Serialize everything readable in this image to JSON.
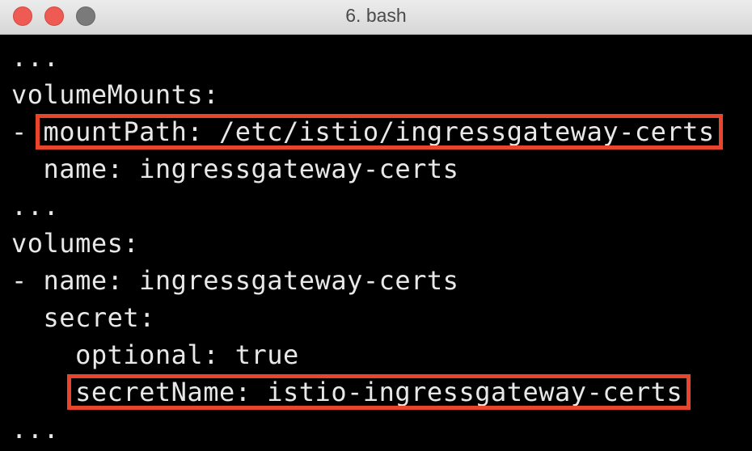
{
  "window": {
    "title": "6. bash"
  },
  "terminal": {
    "lines": [
      {
        "prefix": "...",
        "highlight": ""
      },
      {
        "prefix": "volumeMounts:",
        "highlight": ""
      },
      {
        "prefix": "- ",
        "highlight": "mountPath: /etc/istio/ingressgateway-certs"
      },
      {
        "prefix": "  name: ingressgateway-certs",
        "highlight": ""
      },
      {
        "prefix": "...",
        "highlight": ""
      },
      {
        "prefix": "volumes:",
        "highlight": ""
      },
      {
        "prefix": "- name: ingressgateway-certs",
        "highlight": ""
      },
      {
        "prefix": "  secret:",
        "highlight": ""
      },
      {
        "prefix": "    optional: true",
        "highlight": ""
      },
      {
        "prefix": "    ",
        "highlight": "secretName: istio-ingressgateway-certs"
      },
      {
        "prefix": "...",
        "highlight": ""
      }
    ]
  },
  "colors": {
    "background": "#000000",
    "text": "#e8e8e8",
    "highlight_border": "#e8452c",
    "titlebar": "#e2e2e2"
  },
  "icons": {
    "close": "close-button-icon",
    "minimize": "minimize-button-icon",
    "zoom": "zoom-button-icon"
  }
}
